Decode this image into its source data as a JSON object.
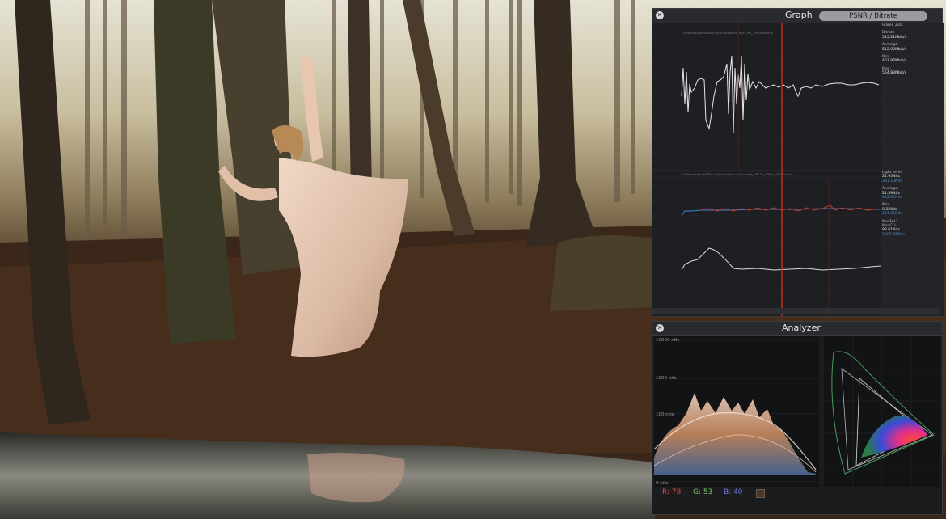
{
  "graph_panel": {
    "title": "Graph",
    "tab_label": "PSNR / Bitrate",
    "top_path": "D:\\Movies\\ForestDance\\ForestDance_HDR_PQ_1000nits.mxf",
    "mid_path": "D:\\Movies\\ForestDance\\ForestDance_Encoded_CRF18_10bit_HDR10.mkv",
    "top_stats": [
      {
        "label": "Frame 220",
        "value": ""
      },
      {
        "label": "Bitrate",
        "value": "515.21Mbit/s"
      },
      {
        "label": "Average:",
        "value": "512.92Mbit/s"
      },
      {
        "label": "Min:",
        "value": "407.97Mbit/s"
      },
      {
        "label": "Max:",
        "value": "564.83Mbit/s"
      }
    ],
    "bottom_stats": [
      {
        "label": "Light level",
        "value": "21.95Nits",
        "value2": "381.10Nits"
      },
      {
        "label": "Average:",
        "value": "21.39Nits",
        "value2": "442.07Nits"
      },
      {
        "label": "Min:",
        "value": "9.25Nits",
        "value2": "251.05Nits"
      },
      {
        "label": "MaxFALL",
        "value": "",
        "value2": ""
      },
      {
        "label": "MaxCLL:",
        "value": "88.61Nits",
        "value2": "1007.55Nits"
      }
    ]
  },
  "analyzer_panel": {
    "title": "Analyzer",
    "nits_labels": [
      "10000 nits",
      "1000 nits",
      "100 nits",
      "0 nits"
    ],
    "pixel_readout": {
      "r": "R: 78",
      "g": "G: 53",
      "b": "B: 40"
    },
    "colors": {
      "r": "#e04848",
      "g": "#7ec85a",
      "b": "#6a74e0",
      "accent": "#d82818",
      "plot_white": "#e8e8e8",
      "plot_blue": "#3f7fd6"
    }
  }
}
